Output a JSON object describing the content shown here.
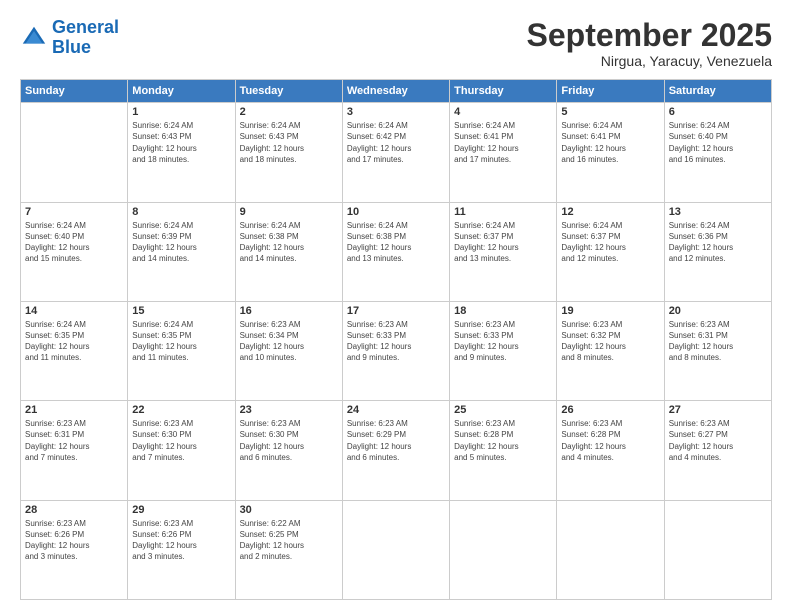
{
  "header": {
    "logo_line1": "General",
    "logo_line2": "Blue",
    "month": "September 2025",
    "location": "Nirgua, Yaracuy, Venezuela"
  },
  "weekdays": [
    "Sunday",
    "Monday",
    "Tuesday",
    "Wednesday",
    "Thursday",
    "Friday",
    "Saturday"
  ],
  "weeks": [
    [
      {
        "day": "",
        "info": ""
      },
      {
        "day": "1",
        "info": "Sunrise: 6:24 AM\nSunset: 6:43 PM\nDaylight: 12 hours\nand 18 minutes."
      },
      {
        "day": "2",
        "info": "Sunrise: 6:24 AM\nSunset: 6:43 PM\nDaylight: 12 hours\nand 18 minutes."
      },
      {
        "day": "3",
        "info": "Sunrise: 6:24 AM\nSunset: 6:42 PM\nDaylight: 12 hours\nand 17 minutes."
      },
      {
        "day": "4",
        "info": "Sunrise: 6:24 AM\nSunset: 6:41 PM\nDaylight: 12 hours\nand 17 minutes."
      },
      {
        "day": "5",
        "info": "Sunrise: 6:24 AM\nSunset: 6:41 PM\nDaylight: 12 hours\nand 16 minutes."
      },
      {
        "day": "6",
        "info": "Sunrise: 6:24 AM\nSunset: 6:40 PM\nDaylight: 12 hours\nand 16 minutes."
      }
    ],
    [
      {
        "day": "7",
        "info": "Sunrise: 6:24 AM\nSunset: 6:40 PM\nDaylight: 12 hours\nand 15 minutes."
      },
      {
        "day": "8",
        "info": "Sunrise: 6:24 AM\nSunset: 6:39 PM\nDaylight: 12 hours\nand 14 minutes."
      },
      {
        "day": "9",
        "info": "Sunrise: 6:24 AM\nSunset: 6:38 PM\nDaylight: 12 hours\nand 14 minutes."
      },
      {
        "day": "10",
        "info": "Sunrise: 6:24 AM\nSunset: 6:38 PM\nDaylight: 12 hours\nand 13 minutes."
      },
      {
        "day": "11",
        "info": "Sunrise: 6:24 AM\nSunset: 6:37 PM\nDaylight: 12 hours\nand 13 minutes."
      },
      {
        "day": "12",
        "info": "Sunrise: 6:24 AM\nSunset: 6:37 PM\nDaylight: 12 hours\nand 12 minutes."
      },
      {
        "day": "13",
        "info": "Sunrise: 6:24 AM\nSunset: 6:36 PM\nDaylight: 12 hours\nand 12 minutes."
      }
    ],
    [
      {
        "day": "14",
        "info": "Sunrise: 6:24 AM\nSunset: 6:35 PM\nDaylight: 12 hours\nand 11 minutes."
      },
      {
        "day": "15",
        "info": "Sunrise: 6:24 AM\nSunset: 6:35 PM\nDaylight: 12 hours\nand 11 minutes."
      },
      {
        "day": "16",
        "info": "Sunrise: 6:23 AM\nSunset: 6:34 PM\nDaylight: 12 hours\nand 10 minutes."
      },
      {
        "day": "17",
        "info": "Sunrise: 6:23 AM\nSunset: 6:33 PM\nDaylight: 12 hours\nand 9 minutes."
      },
      {
        "day": "18",
        "info": "Sunrise: 6:23 AM\nSunset: 6:33 PM\nDaylight: 12 hours\nand 9 minutes."
      },
      {
        "day": "19",
        "info": "Sunrise: 6:23 AM\nSunset: 6:32 PM\nDaylight: 12 hours\nand 8 minutes."
      },
      {
        "day": "20",
        "info": "Sunrise: 6:23 AM\nSunset: 6:31 PM\nDaylight: 12 hours\nand 8 minutes."
      }
    ],
    [
      {
        "day": "21",
        "info": "Sunrise: 6:23 AM\nSunset: 6:31 PM\nDaylight: 12 hours\nand 7 minutes."
      },
      {
        "day": "22",
        "info": "Sunrise: 6:23 AM\nSunset: 6:30 PM\nDaylight: 12 hours\nand 7 minutes."
      },
      {
        "day": "23",
        "info": "Sunrise: 6:23 AM\nSunset: 6:30 PM\nDaylight: 12 hours\nand 6 minutes."
      },
      {
        "day": "24",
        "info": "Sunrise: 6:23 AM\nSunset: 6:29 PM\nDaylight: 12 hours\nand 6 minutes."
      },
      {
        "day": "25",
        "info": "Sunrise: 6:23 AM\nSunset: 6:28 PM\nDaylight: 12 hours\nand 5 minutes."
      },
      {
        "day": "26",
        "info": "Sunrise: 6:23 AM\nSunset: 6:28 PM\nDaylight: 12 hours\nand 4 minutes."
      },
      {
        "day": "27",
        "info": "Sunrise: 6:23 AM\nSunset: 6:27 PM\nDaylight: 12 hours\nand 4 minutes."
      }
    ],
    [
      {
        "day": "28",
        "info": "Sunrise: 6:23 AM\nSunset: 6:26 PM\nDaylight: 12 hours\nand 3 minutes."
      },
      {
        "day": "29",
        "info": "Sunrise: 6:23 AM\nSunset: 6:26 PM\nDaylight: 12 hours\nand 3 minutes."
      },
      {
        "day": "30",
        "info": "Sunrise: 6:22 AM\nSunset: 6:25 PM\nDaylight: 12 hours\nand 2 minutes."
      },
      {
        "day": "",
        "info": ""
      },
      {
        "day": "",
        "info": ""
      },
      {
        "day": "",
        "info": ""
      },
      {
        "day": "",
        "info": ""
      }
    ]
  ]
}
